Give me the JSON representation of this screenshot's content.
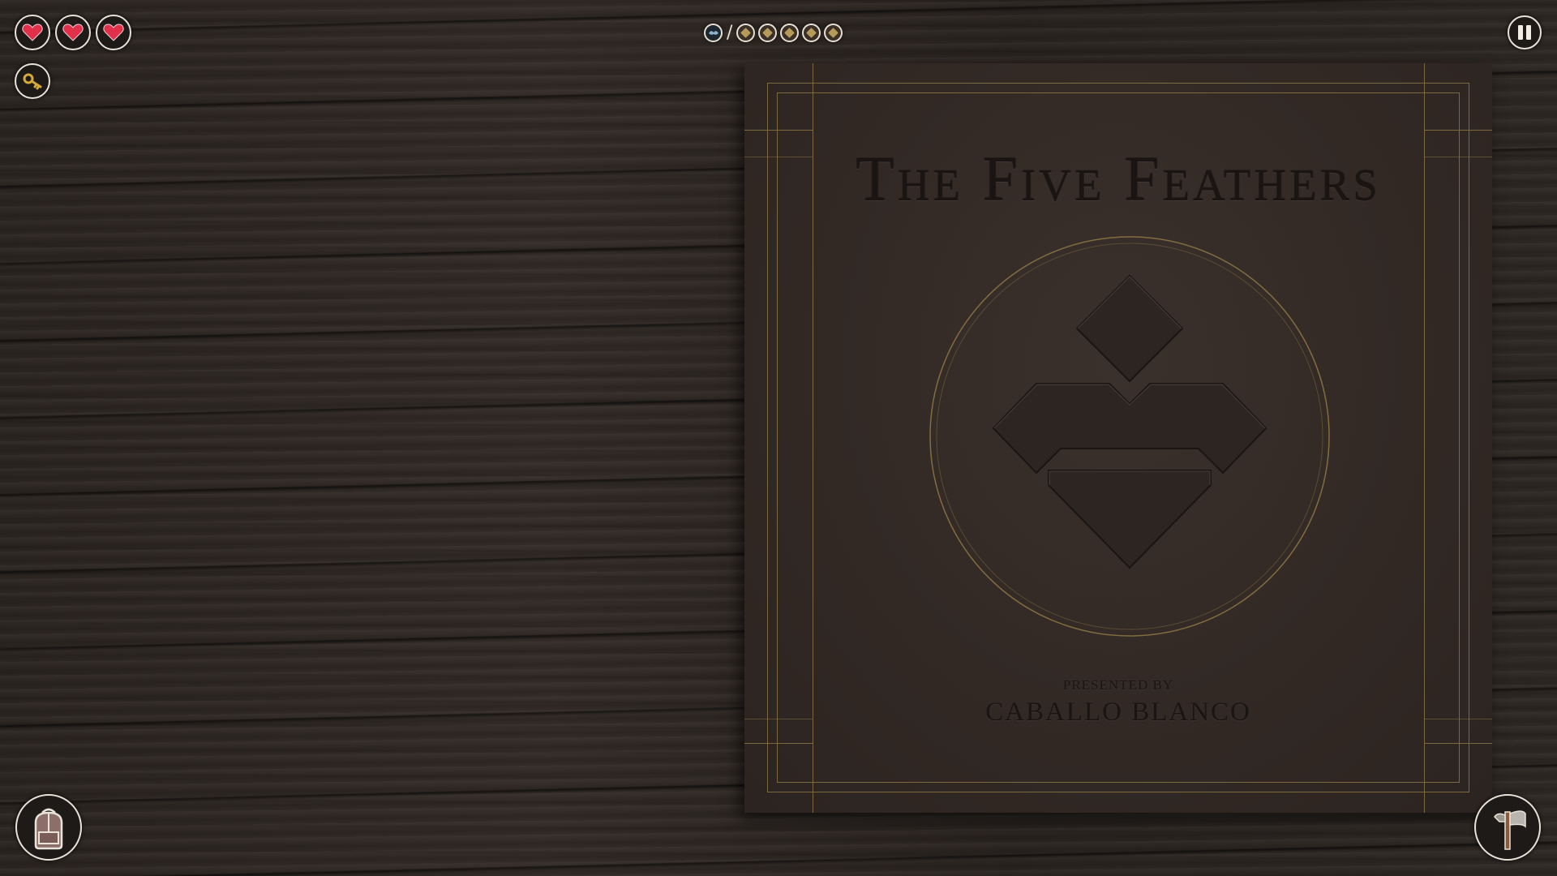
{
  "hud": {
    "hearts": [
      "heart",
      "heart",
      "heart"
    ],
    "heart_color": "#e0304a",
    "key_icon": "key-icon",
    "pause_icon": "pause-icon",
    "backpack_icon": "backpack-icon",
    "axe_icon": "axe-icon",
    "feather_tokens": {
      "collected_marker": "bird-icon",
      "separator": "/",
      "total_slots": 5
    }
  },
  "book": {
    "title": "The Five Feathers",
    "presented_by": "PRESENTED BY",
    "author": "CABALLO BLANCO",
    "border_color": "#8a7443",
    "cover_color": "#322925"
  }
}
